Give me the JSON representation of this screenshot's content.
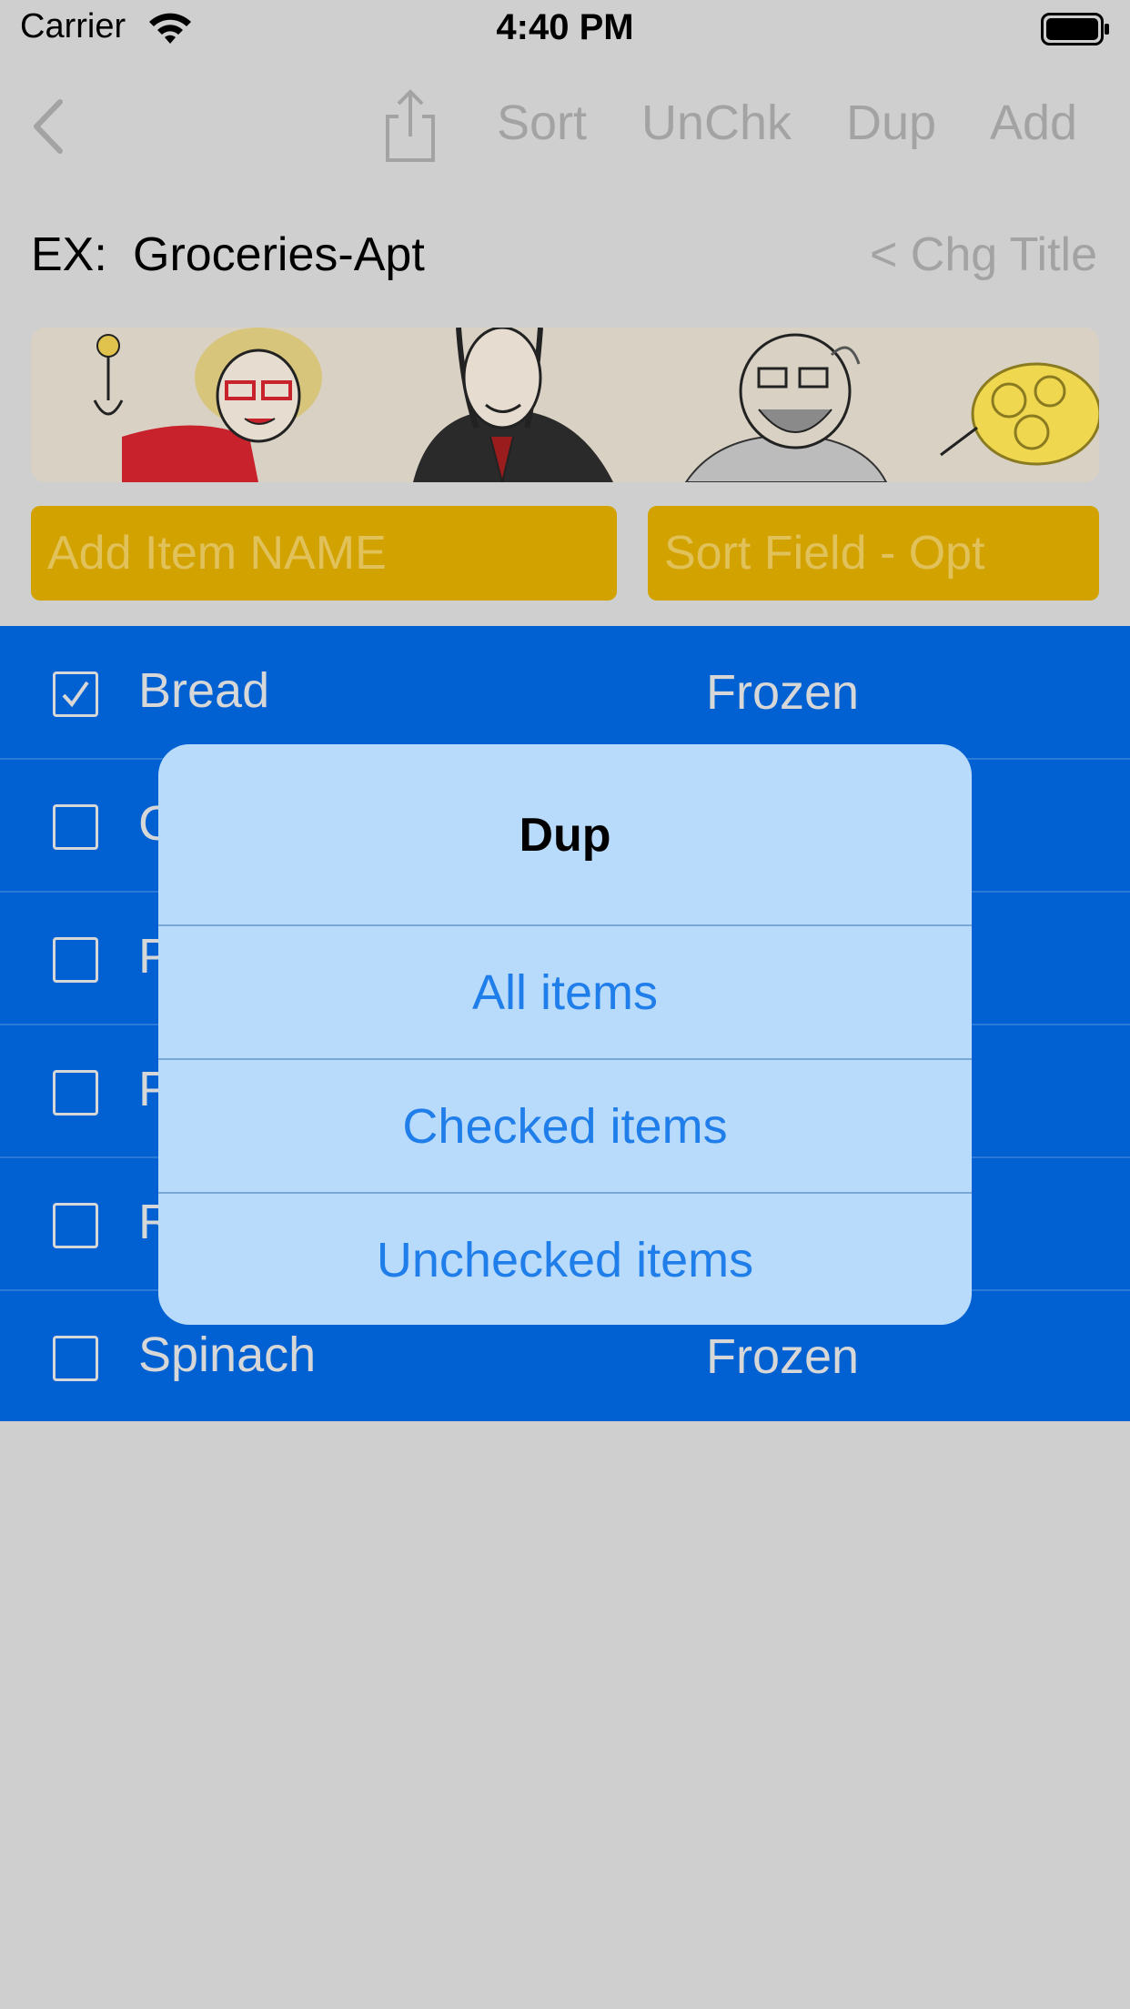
{
  "status_bar": {
    "carrier": "Carrier",
    "time": "4:40 PM"
  },
  "nav": {
    "sort": "Sort",
    "uncheck": "UnChk",
    "dup": "Dup",
    "add": "Add"
  },
  "header": {
    "prefix": "EX:",
    "title": "Groceries-Apt",
    "change_title": "< Chg Title"
  },
  "inputs": {
    "item_name_placeholder": "Add Item NAME",
    "sort_field_placeholder": "Sort Field - Opt"
  },
  "items": [
    {
      "name": "Bread",
      "sort": "Frozen",
      "checked": true
    },
    {
      "name": "C",
      "sort": "",
      "checked": false
    },
    {
      "name": "P",
      "sort": "",
      "checked": false
    },
    {
      "name": "P",
      "sort": "",
      "checked": false
    },
    {
      "name": "R",
      "sort": "",
      "checked": false
    },
    {
      "name": "Spinach",
      "sort": "Frozen",
      "checked": false
    }
  ],
  "dialog": {
    "title": "Dup",
    "options": [
      "All items",
      "Checked items",
      "Unchecked items"
    ]
  },
  "colors": {
    "background": "#cfcfcf",
    "list_blue": "#0161d2",
    "field_yellow": "#d2a300",
    "dialog_bg": "#b9dbfb",
    "dialog_text_blue": "#1f7ee9"
  }
}
